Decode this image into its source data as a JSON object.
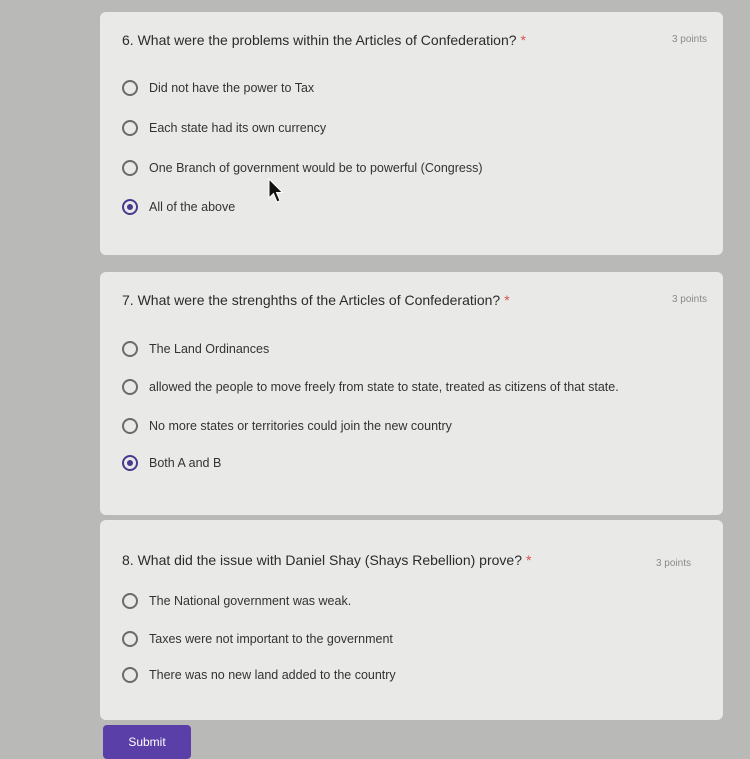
{
  "questions": [
    {
      "title": "6. What were the problems within the Articles of Confederation?",
      "required_mark": "*",
      "points": "3 points",
      "options": [
        {
          "label": "Did not have the power to Tax",
          "selected": false
        },
        {
          "label": "Each state had its own currency",
          "selected": false
        },
        {
          "label": "One Branch of government would be to powerful (Congress)",
          "selected": false
        },
        {
          "label": "All of the above",
          "selected": true
        }
      ]
    },
    {
      "title": "7. What were the strenghths of the Articles of Confederation?",
      "required_mark": "*",
      "points": "3 points",
      "options": [
        {
          "label": "The Land Ordinances",
          "selected": false
        },
        {
          "label": "allowed the people to move freely from state to state, treated as citizens of that state.",
          "selected": false
        },
        {
          "label": "No more states or territories could join the new country",
          "selected": false
        },
        {
          "label": "Both A and B",
          "selected": true
        }
      ]
    },
    {
      "title": "8. What did the issue with Daniel Shay (Shays Rebellion) prove?",
      "required_mark": "*",
      "points": "3 points",
      "options": [
        {
          "label": "The National government was weak.",
          "selected": false
        },
        {
          "label": "Taxes were not important to the government",
          "selected": false
        },
        {
          "label": "There was no new land added to the country",
          "selected": false
        }
      ]
    }
  ],
  "submit_label": "Submit",
  "accent_color": "#4a3a8f"
}
